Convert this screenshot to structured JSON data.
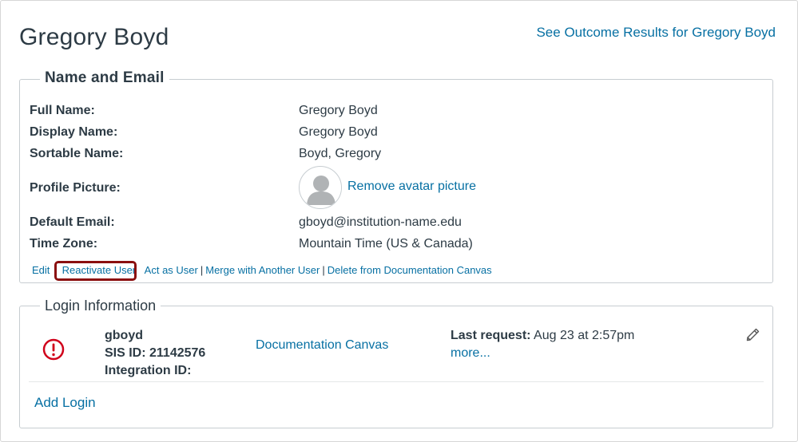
{
  "header": {
    "title": "Gregory Boyd",
    "outcome_link": "See Outcome Results for Gregory Boyd"
  },
  "name_email": {
    "legend": "Name and Email",
    "fields": [
      {
        "label": "Full Name:",
        "value": "Gregory Boyd"
      },
      {
        "label": "Display Name:",
        "value": "Gregory Boyd"
      },
      {
        "label": "Sortable Name:",
        "value": "Boyd, Gregory"
      },
      {
        "label": "Profile Picture:",
        "value": "Remove avatar picture"
      },
      {
        "label": "Default Email:",
        "value": "gboyd@institution-name.edu"
      },
      {
        "label": "Time Zone:",
        "value": "Mountain Time (US & Canada)"
      }
    ],
    "actions": [
      "Edit",
      "Reactivate User",
      "Act as User",
      "Merge with Another User",
      "Delete from Documentation Canvas"
    ],
    "separator": "|"
  },
  "login_info": {
    "legend": "Login Information",
    "username": "gboyd",
    "sis_id": "SIS ID: 21142576",
    "integration_id": "Integration ID:",
    "account": "Documentation Canvas",
    "last_request_label": "Last request:",
    "last_request_value": "Aug 23 at 2:57pm",
    "more": "more...",
    "add_login": "Add Login"
  },
  "colors": {
    "link": "#0770a3",
    "text": "#2d3b45",
    "highlight": "#8b0f0f",
    "alert": "#d0021b"
  },
  "icons": {
    "alert": "alert-circle-icon",
    "edit": "pencil-icon",
    "avatar": "default-avatar-icon"
  }
}
